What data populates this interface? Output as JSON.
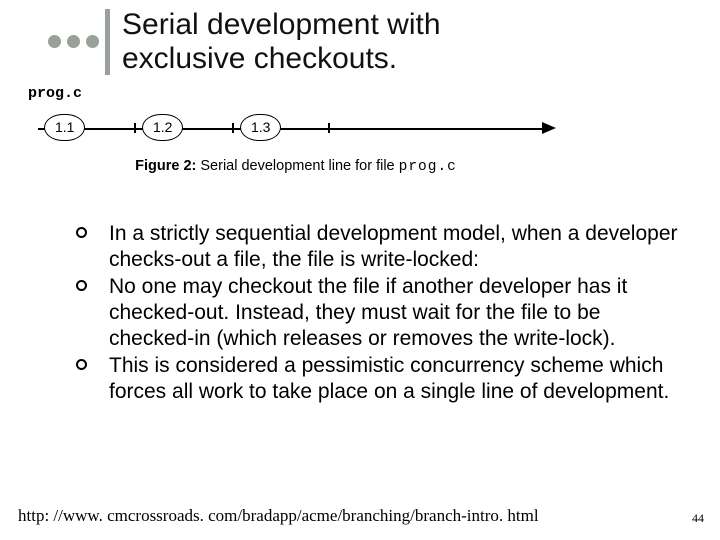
{
  "title": {
    "line1": "Serial development with",
    "line2": "exclusive checkouts."
  },
  "figure": {
    "file_label": "prog.c",
    "versions": [
      "1.1",
      "1.2",
      "1.3"
    ],
    "caption_label": "Figure 2:",
    "caption_text": "Serial development line for file",
    "caption_file": "prog.c"
  },
  "bullets": [
    "In a strictly sequential development model, when a developer checks-out a file, the file is write-locked:",
    "No one may checkout the file if another developer has it checked-out. Instead, they must wait for the file to be checked-in (which releases or removes the write-lock).",
    "This is considered a pessimistic concurrency scheme which forces all work to take place on a single line of development."
  ],
  "footer_url": "http: //www. cmcrossroads. com/bradapp/acme/branching/branch-intro. html",
  "page_number": "44"
}
